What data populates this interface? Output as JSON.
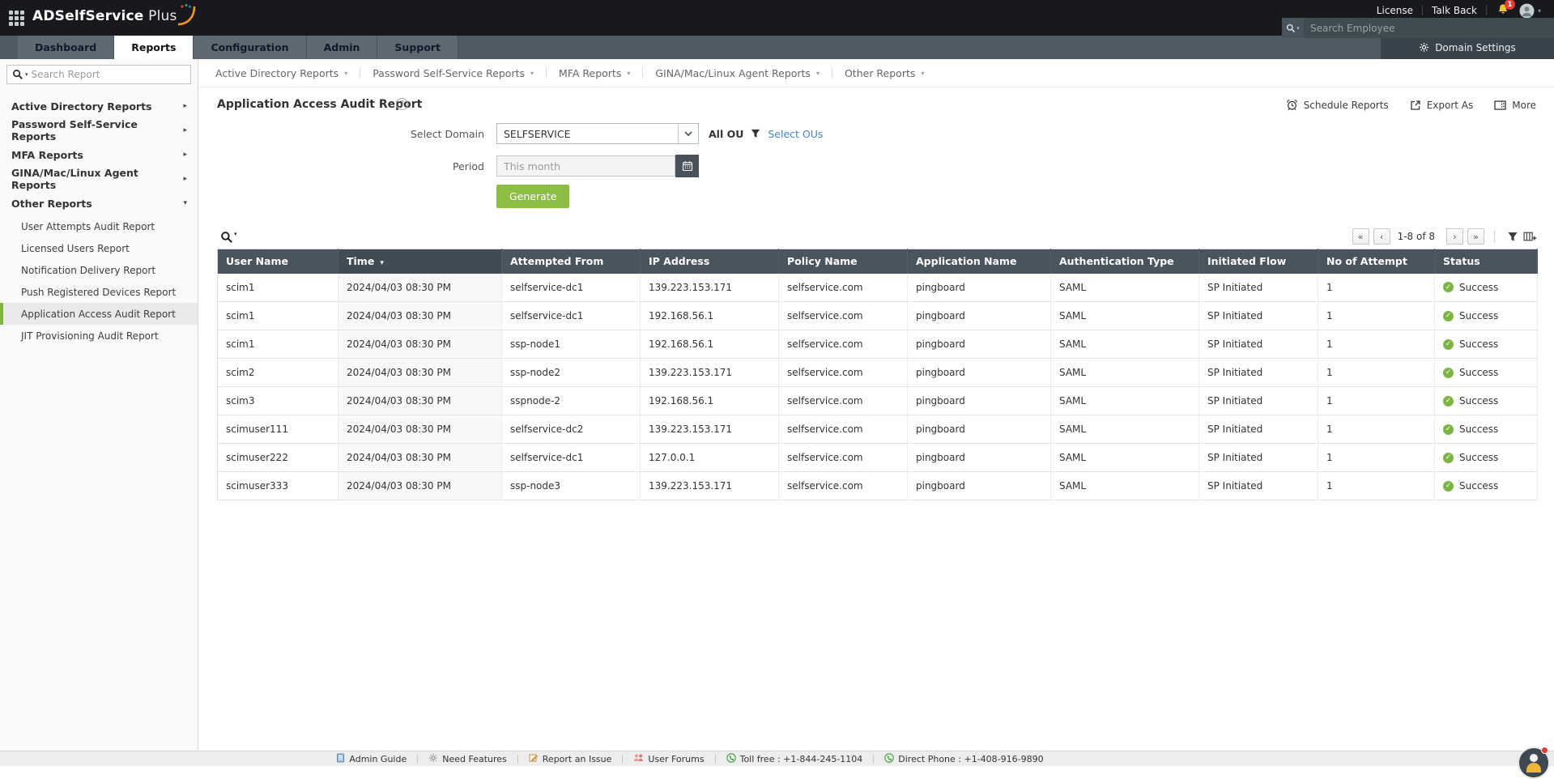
{
  "header": {
    "brand_bold": "ADSelfService",
    "brand_plus": " Plus",
    "license_label": "License",
    "talkback_label": "Talk Back",
    "notification_count": "1",
    "employee_search_placeholder": "Search Employee",
    "domain_settings_label": "Domain Settings",
    "tabs": [
      {
        "label": "Dashboard",
        "active": false
      },
      {
        "label": "Reports",
        "active": true
      },
      {
        "label": "Configuration",
        "active": false
      },
      {
        "label": "Admin",
        "active": false
      },
      {
        "label": "Support",
        "active": false
      }
    ]
  },
  "sidebar": {
    "search_placeholder": "Search Report",
    "items": [
      {
        "label": "Active Directory Reports",
        "state": "collapsed"
      },
      {
        "label": "Password Self-Service Reports",
        "state": "collapsed"
      },
      {
        "label": "MFA Reports",
        "state": "collapsed"
      },
      {
        "label": "GINA/Mac/Linux Agent Reports",
        "state": "collapsed"
      },
      {
        "label": "Other Reports",
        "state": "expanded"
      }
    ],
    "sub_items": [
      {
        "label": "User Attempts Audit Report",
        "active": false
      },
      {
        "label": "Licensed Users Report",
        "active": false
      },
      {
        "label": "Notification Delivery Report",
        "active": false
      },
      {
        "label": "Push Registered Devices Report",
        "active": false
      },
      {
        "label": "Application Access Audit Report",
        "active": true
      },
      {
        "label": "JIT Provisioning Audit Report",
        "active": false
      }
    ]
  },
  "topnav": {
    "items": [
      "Active Directory Reports",
      "Password Self-Service Reports",
      "MFA Reports",
      "GINA/Mac/Linux Agent Reports",
      "Other Reports"
    ]
  },
  "page": {
    "title": "Application Access Audit Report",
    "actions": {
      "schedule": "Schedule Reports",
      "export": "Export As",
      "more": "More"
    }
  },
  "form": {
    "domain_label": "Select Domain",
    "domain_value": "SELFSERVICE",
    "ou_label": "All OU",
    "ou_link": "Select OUs",
    "period_label": "Period",
    "period_value": "This month",
    "generate_label": "Generate"
  },
  "table": {
    "pagination": {
      "range": "1-8 of 8"
    },
    "columns": [
      {
        "label": "User Name",
        "sorted": false
      },
      {
        "label": "Time",
        "sorted": true
      },
      {
        "label": "Attempted From",
        "sorted": false
      },
      {
        "label": "IP Address",
        "sorted": false
      },
      {
        "label": "Policy Name",
        "sorted": false
      },
      {
        "label": "Application Name",
        "sorted": false
      },
      {
        "label": "Authentication Type",
        "sorted": false
      },
      {
        "label": "Initiated Flow",
        "sorted": false
      },
      {
        "label": "No of Attempt",
        "sorted": false
      },
      {
        "label": "Status",
        "sorted": false
      }
    ],
    "rows": [
      {
        "user": "scim1",
        "time": "2024/04/03 08:30 PM",
        "attempted_from": "selfservice-dc1",
        "ip": "139.223.153.171",
        "policy": "selfservice.com",
        "app": "pingboard",
        "auth": "SAML",
        "flow": "SP Initiated",
        "attempts": "1",
        "status": "Success"
      },
      {
        "user": "scim1",
        "time": "2024/04/03 08:30 PM",
        "attempted_from": "selfservice-dc1",
        "ip": "192.168.56.1",
        "policy": "selfservice.com",
        "app": "pingboard",
        "auth": "SAML",
        "flow": "SP Initiated",
        "attempts": "1",
        "status": "Success"
      },
      {
        "user": "scim1",
        "time": "2024/04/03 08:30 PM",
        "attempted_from": "ssp-node1",
        "ip": "192.168.56.1",
        "policy": "selfservice.com",
        "app": "pingboard",
        "auth": "SAML",
        "flow": "SP Initiated",
        "attempts": "1",
        "status": "Success"
      },
      {
        "user": "scim2",
        "time": "2024/04/03 08:30 PM",
        "attempted_from": "ssp-node2",
        "ip": "139.223.153.171",
        "policy": "selfservice.com",
        "app": "pingboard",
        "auth": "SAML",
        "flow": "SP Initiated",
        "attempts": "1",
        "status": "Success"
      },
      {
        "user": "scim3",
        "time": "2024/04/03 08:30 PM",
        "attempted_from": "sspnode-2",
        "ip": "192.168.56.1",
        "policy": "selfservice.com",
        "app": "pingboard",
        "auth": "SAML",
        "flow": "SP Initiated",
        "attempts": "1",
        "status": "Success"
      },
      {
        "user": "scimuser111",
        "time": "2024/04/03 08:30 PM",
        "attempted_from": "selfservice-dc2",
        "ip": "139.223.153.171",
        "policy": "selfservice.com",
        "app": "pingboard",
        "auth": "SAML",
        "flow": "SP Initiated",
        "attempts": "1",
        "status": "Success"
      },
      {
        "user": "scimuser222",
        "time": "2024/04/03 08:30 PM",
        "attempted_from": "selfservice-dc1",
        "ip": "127.0.0.1",
        "policy": "selfservice.com",
        "app": "pingboard",
        "auth": "SAML",
        "flow": "SP Initiated",
        "attempts": "1",
        "status": "Success"
      },
      {
        "user": "scimuser333",
        "time": "2024/04/03 08:30 PM",
        "attempted_from": "ssp-node3",
        "ip": "139.223.153.171",
        "policy": "selfservice.com",
        "app": "pingboard",
        "auth": "SAML",
        "flow": "SP Initiated",
        "attempts": "1",
        "status": "Success"
      }
    ]
  },
  "footer": {
    "items": [
      {
        "icon": "guide",
        "label": "Admin Guide"
      },
      {
        "icon": "features",
        "label": "Need Features"
      },
      {
        "icon": "issue",
        "label": "Report an Issue"
      },
      {
        "icon": "forums",
        "label": "User Forums"
      },
      {
        "icon": "phone",
        "label": "Toll free : +1-844-245-1104"
      },
      {
        "icon": "phone",
        "label": "Direct Phone : +1-408-916-9890"
      }
    ]
  },
  "colors": {
    "topbar": "#17191d",
    "tabbar": "#4e5a64",
    "accent_green": "#8cbe44",
    "active_item_green": "#7db63f",
    "table_header": "#4a545e",
    "link_blue": "#4186c7",
    "success_green": "#7cb543"
  }
}
